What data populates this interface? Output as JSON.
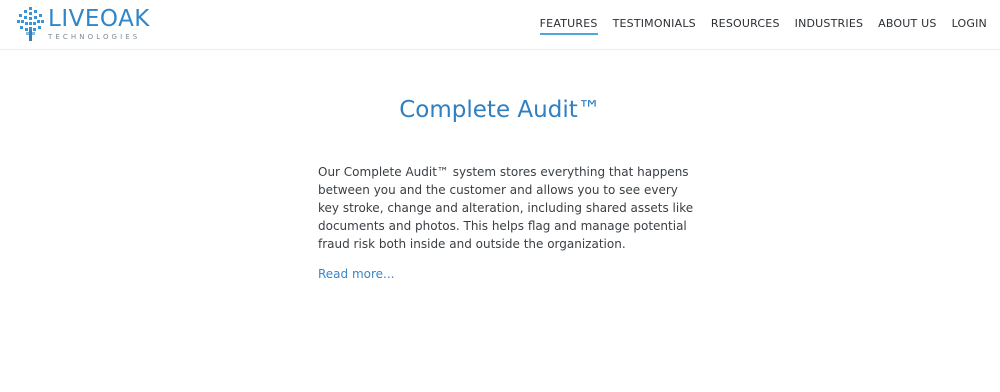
{
  "logo": {
    "name": "LIVEOAK",
    "subtitle": "TECHNOLOGIES",
    "icon": "liveoak-tree-grid-icon",
    "color": "#2f86c8"
  },
  "nav": {
    "items": [
      {
        "label": "FEATURES",
        "active": true
      },
      {
        "label": "TESTIMONIALS",
        "active": false
      },
      {
        "label": "RESOURCES",
        "active": false
      },
      {
        "label": "INDUSTRIES",
        "active": false
      },
      {
        "label": "ABOUT US",
        "active": false
      },
      {
        "label": "LOGIN",
        "active": false
      }
    ],
    "active_underline_color": "#4fa6da"
  },
  "main": {
    "title": "Complete Audit™",
    "body": "Our Complete Audit™ system stores everything that happens between you and the customer and allows you to see every key stroke, change and alteration, including shared assets like documents and photos. This helps flag and manage potential fraud risk both inside and outside the organization.",
    "read_more": "Read more..."
  },
  "colors": {
    "title": "#2f7fc1",
    "link": "#3b86c6",
    "text": "#3a3f44"
  }
}
